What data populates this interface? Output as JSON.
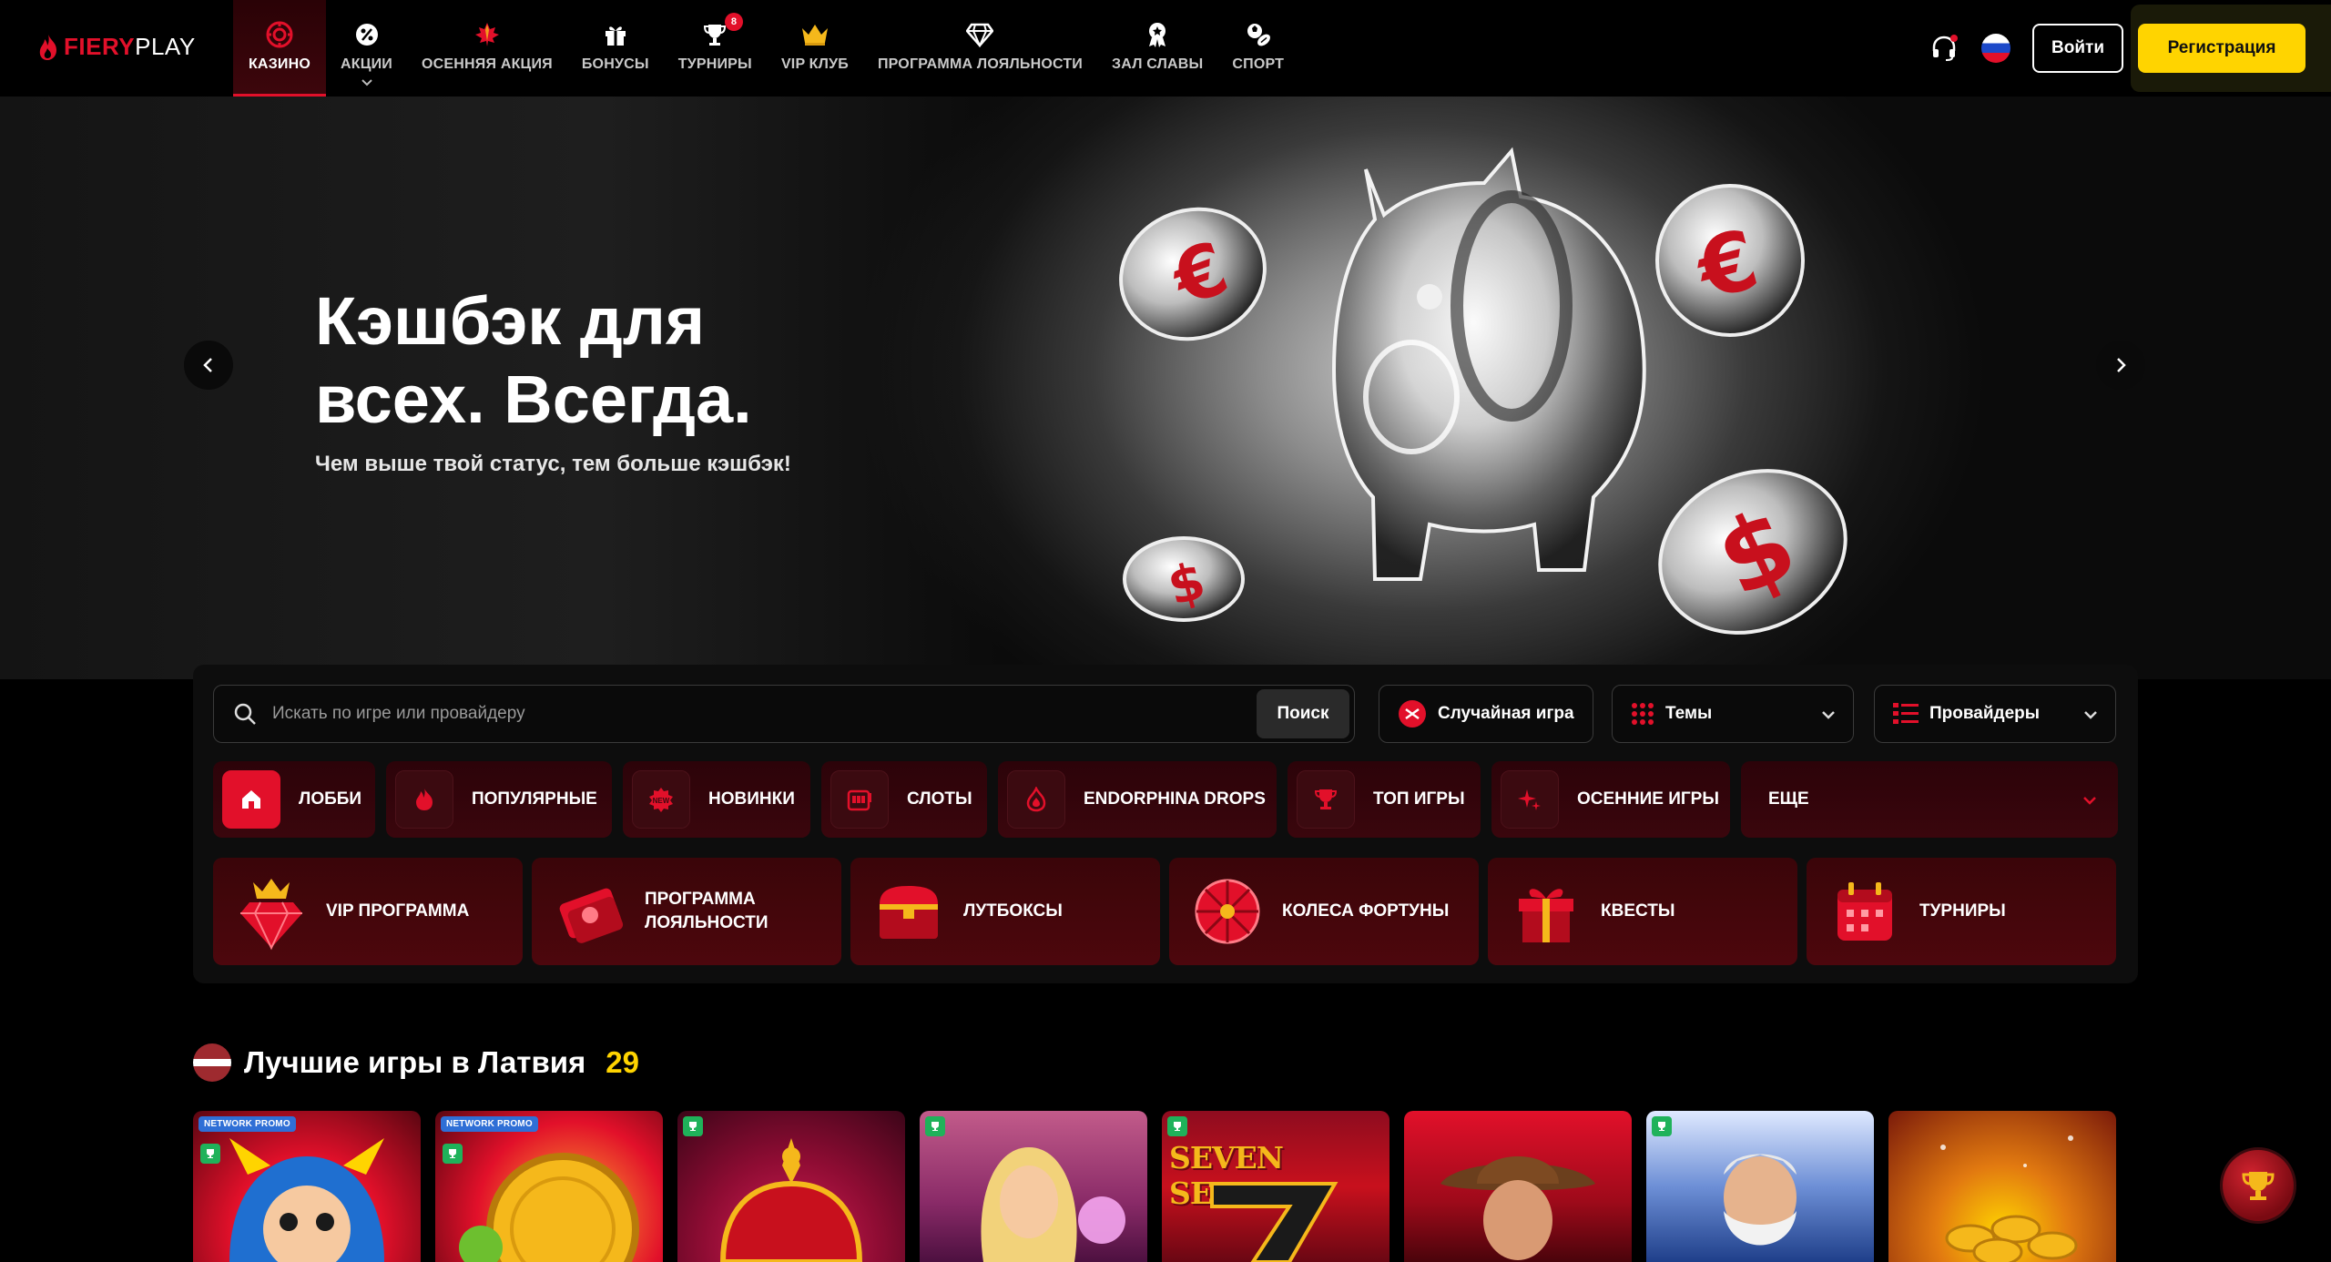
{
  "brand": {
    "name_part1": "FIERY",
    "name_part2": "PLAY",
    "accent": "#e2102a",
    "yellow": "#ffd400"
  },
  "nav": {
    "items": [
      {
        "label": "КАЗИНО",
        "icon": "chip-icon",
        "active": true
      },
      {
        "label": "АКЦИИ",
        "icon": "promo-icon",
        "caret": true
      },
      {
        "label": "ОСЕННЯЯ АКЦИЯ",
        "icon": "maple-leaf-icon"
      },
      {
        "label": "БОНУСЫ",
        "icon": "gift-icon"
      },
      {
        "label": "ТУРНИРЫ",
        "icon": "trophy-icon",
        "badge": "8"
      },
      {
        "label": "VIP КЛУБ",
        "icon": "crown-icon"
      },
      {
        "label": "ПРОГРАММА ЛОЯЛЬНОСТИ",
        "icon": "diamond-icon"
      },
      {
        "label": "ЗАЛ СЛАВЫ",
        "icon": "award-icon"
      },
      {
        "label": "СПОРТ",
        "icon": "sport-icon"
      }
    ],
    "login_label": "Войти",
    "register_label": "Регистрация"
  },
  "hero": {
    "title_line1": "Кэшбэк для",
    "title_line2": "всех. Всегда.",
    "subtitle": "Чем выше твой статус, тем больше кэшбэк!"
  },
  "filters": {
    "search_placeholder": "Искать по игре или провайдеру",
    "search_button": "Поиск",
    "random_game": "Случайная игра",
    "themes": "Темы",
    "providers": "Провайдеры"
  },
  "categories": [
    {
      "label": "ЛОББИ",
      "icon": "home-icon",
      "active": true
    },
    {
      "label": "ПОПУЛЯРНЫЕ",
      "icon": "flame-icon"
    },
    {
      "label": "НОВИНКИ",
      "icon": "new-icon"
    },
    {
      "label": "СЛОТЫ",
      "icon": "slot-icon"
    },
    {
      "label": "ENDORPHINA DROPS",
      "icon": "drop-icon"
    },
    {
      "label": "ТОП ИГРЫ",
      "icon": "cup-icon"
    },
    {
      "label": "ОСЕННИЕ ИГРЫ",
      "icon": "sparkle-icon"
    },
    {
      "label": "ЕЩЕ",
      "icon": "chevron-down-icon"
    }
  ],
  "features": [
    {
      "line1": "VIP ПРОГРАММА",
      "line2": "",
      "icon": "vip-gem-icon"
    },
    {
      "line1": "ПРОГРАММА",
      "line2": "ЛОЯЛЬНОСТИ",
      "icon": "loyalty-card-icon"
    },
    {
      "line1": "ЛУТБОКСЫ",
      "line2": "",
      "icon": "chest-icon"
    },
    {
      "line1": "КОЛЕСА ФОРТУНЫ",
      "line2": "",
      "icon": "wheel-icon"
    },
    {
      "line1": "КВЕСТЫ",
      "line2": "",
      "icon": "quest-gift-icon"
    },
    {
      "line1": "ТУРНИРЫ",
      "line2": "",
      "icon": "calendar-icon"
    }
  ],
  "section": {
    "title": "Лучшие игры в Латвия",
    "count": "29"
  },
  "games": [
    {
      "promo": "NETWORK PROMO",
      "theme": "jester"
    },
    {
      "promo": "NETWORK PROMO",
      "theme": "coin"
    },
    {
      "promo": "",
      "theme": "crown"
    },
    {
      "promo": "",
      "theme": "blonde"
    },
    {
      "promo": "",
      "theme": "seven",
      "text": "SEVEN SEVEN"
    },
    {
      "promo": "",
      "theme": "adventurer"
    },
    {
      "promo": "",
      "theme": "zeus"
    },
    {
      "promo": "",
      "theme": "gold"
    }
  ]
}
